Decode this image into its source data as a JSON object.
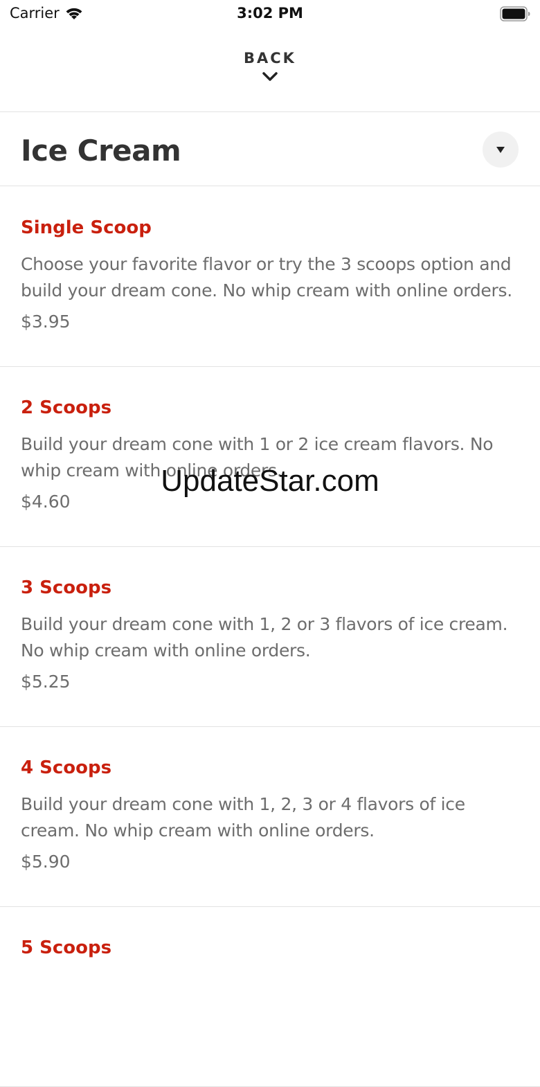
{
  "status_bar": {
    "carrier": "Carrier",
    "time": "3:02 PM"
  },
  "header": {
    "back_label": "BACK"
  },
  "category": {
    "title": "Ice Cream"
  },
  "menu_items": [
    {
      "name": "Single Scoop",
      "description": "Choose your favorite flavor or try the 3 scoops option and build your dream cone. No whip cream with online orders.",
      "price": "$3.95"
    },
    {
      "name": "2 Scoops",
      "description": "Build your dream cone with 1 or 2 ice cream flavors. No whip cream with online orders.",
      "price": "$4.60"
    },
    {
      "name": "3 Scoops",
      "description": "Build your dream cone with 1, 2 or 3 flavors of ice cream. No whip cream with online orders.",
      "price": "$5.25"
    },
    {
      "name": "4 Scoops",
      "description": "Build your dream cone with 1, 2, 3 or 4 flavors of ice cream. No whip cream with online orders.",
      "price": "$5.90"
    },
    {
      "name": "5 Scoops"
    }
  ],
  "watermark": "UpdateStar.com",
  "colors": {
    "accent": "#c9200e",
    "body_text": "#6d6d6d",
    "title_text": "#333333",
    "divider": "#e2e2e2"
  },
  "icons": {
    "wifi": "wifi-icon",
    "battery": "battery-icon",
    "back_chevron": "chevron-down-icon",
    "category_toggle": "caret-down-icon"
  }
}
